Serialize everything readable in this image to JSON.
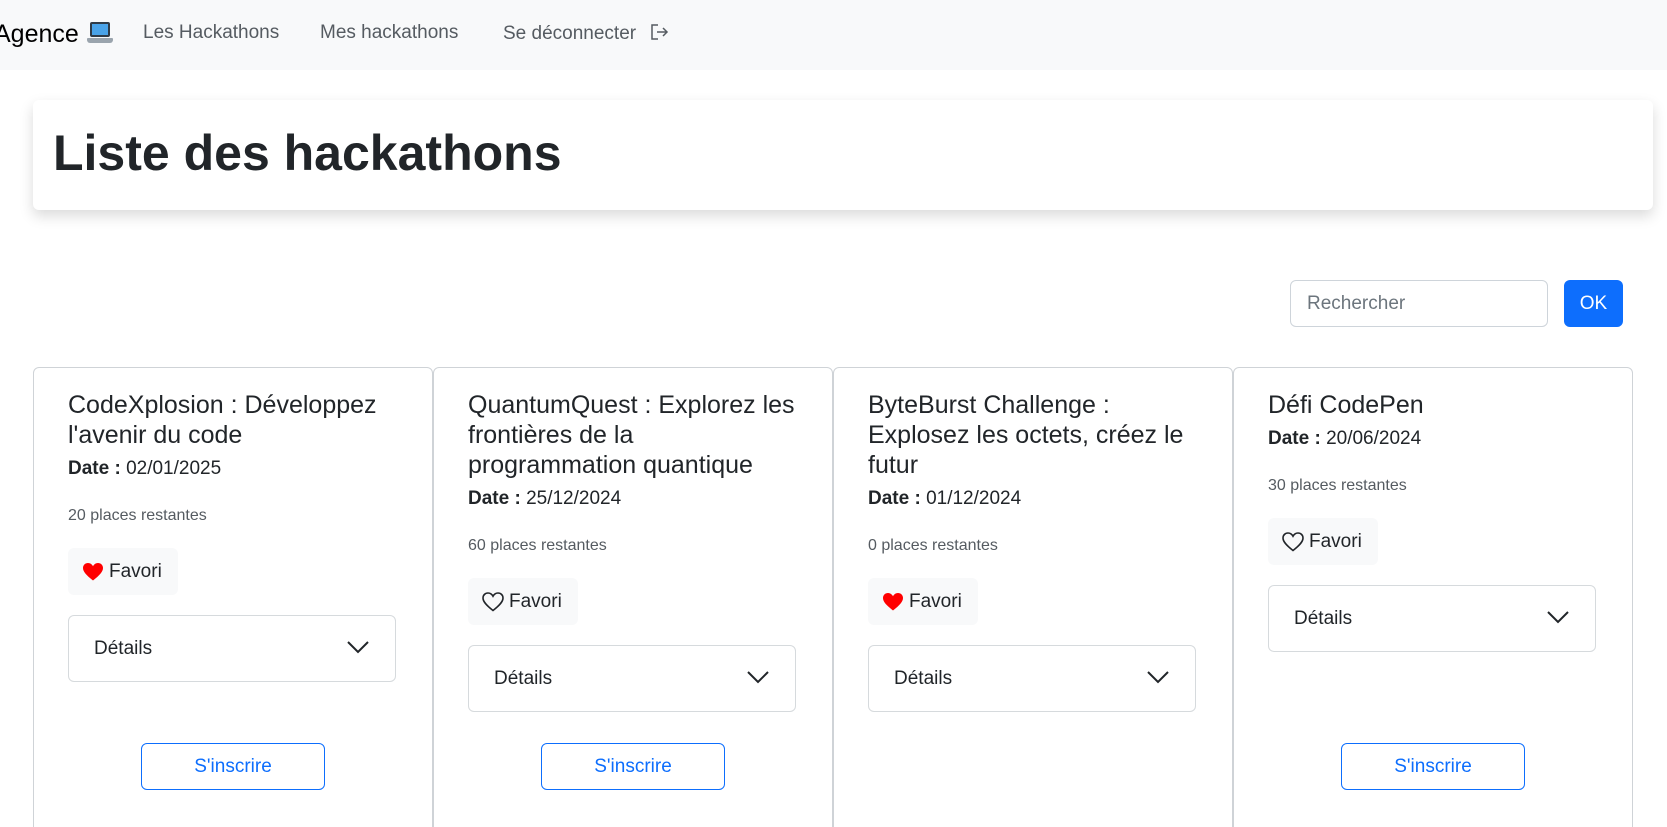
{
  "navbar": {
    "brand": "Agence",
    "links": {
      "hackathons": "Les Hackathons",
      "mes_hackathons": "Mes hackathons",
      "logout": "Se déconnecter"
    }
  },
  "page_title": "Liste des hackathons",
  "search": {
    "placeholder": "Rechercher",
    "value": "",
    "button": "OK"
  },
  "colors": {
    "primary": "#0d6efd",
    "heart_filled": "#ff0000",
    "navbar_bg": "#f8f9fa"
  },
  "labels": {
    "date": "Date :",
    "favori": "Favori",
    "details": "Détails",
    "sinscrire": "S'inscrire"
  },
  "cards": [
    {
      "title": "CodeXplosion : Développez l'avenir du code",
      "date": "02/01/2025",
      "places": "20 places restantes",
      "favorite": true,
      "can_signup": true
    },
    {
      "title": "QuantumQuest : Explorez les frontières de la programmation quantique",
      "date": "25/12/2024",
      "places": "60 places restantes",
      "favorite": false,
      "can_signup": true
    },
    {
      "title": "ByteBurst Challenge : Explosez les octets, créez le futur",
      "date": "01/12/2024",
      "places": "0 places restantes",
      "favorite": true,
      "can_signup": false
    },
    {
      "title": "Défi CodePen",
      "date": "20/06/2024",
      "places": "30 places restantes",
      "favorite": false,
      "can_signup": true
    }
  ]
}
